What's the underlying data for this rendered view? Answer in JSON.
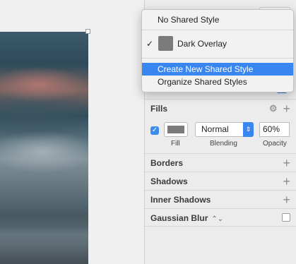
{
  "menu": {
    "items": [
      {
        "label": "No Shared Style"
      },
      {
        "label": "Dark Overlay",
        "checked": true
      },
      {
        "label": "Create New Shared Style",
        "highlighted": true
      },
      {
        "label": "Organize Shared Styles"
      }
    ],
    "check_mark": "✓"
  },
  "sections": {
    "fills": "Fills",
    "borders": "Borders",
    "shadows": "Shadows",
    "inner_shadows": "Inner Shadows",
    "gaussian_blur": "Gaussian Blur"
  },
  "fill": {
    "enabled": true,
    "color": "#7a7a7a",
    "blending": "Normal",
    "opacity": "60%",
    "fill_label": "Fill",
    "blending_label": "Blending",
    "opacity_label": "Opacity"
  },
  "gaussian_blur_enabled": false,
  "colors": {
    "accent": "#3a86f0",
    "panel": "#ececec"
  }
}
